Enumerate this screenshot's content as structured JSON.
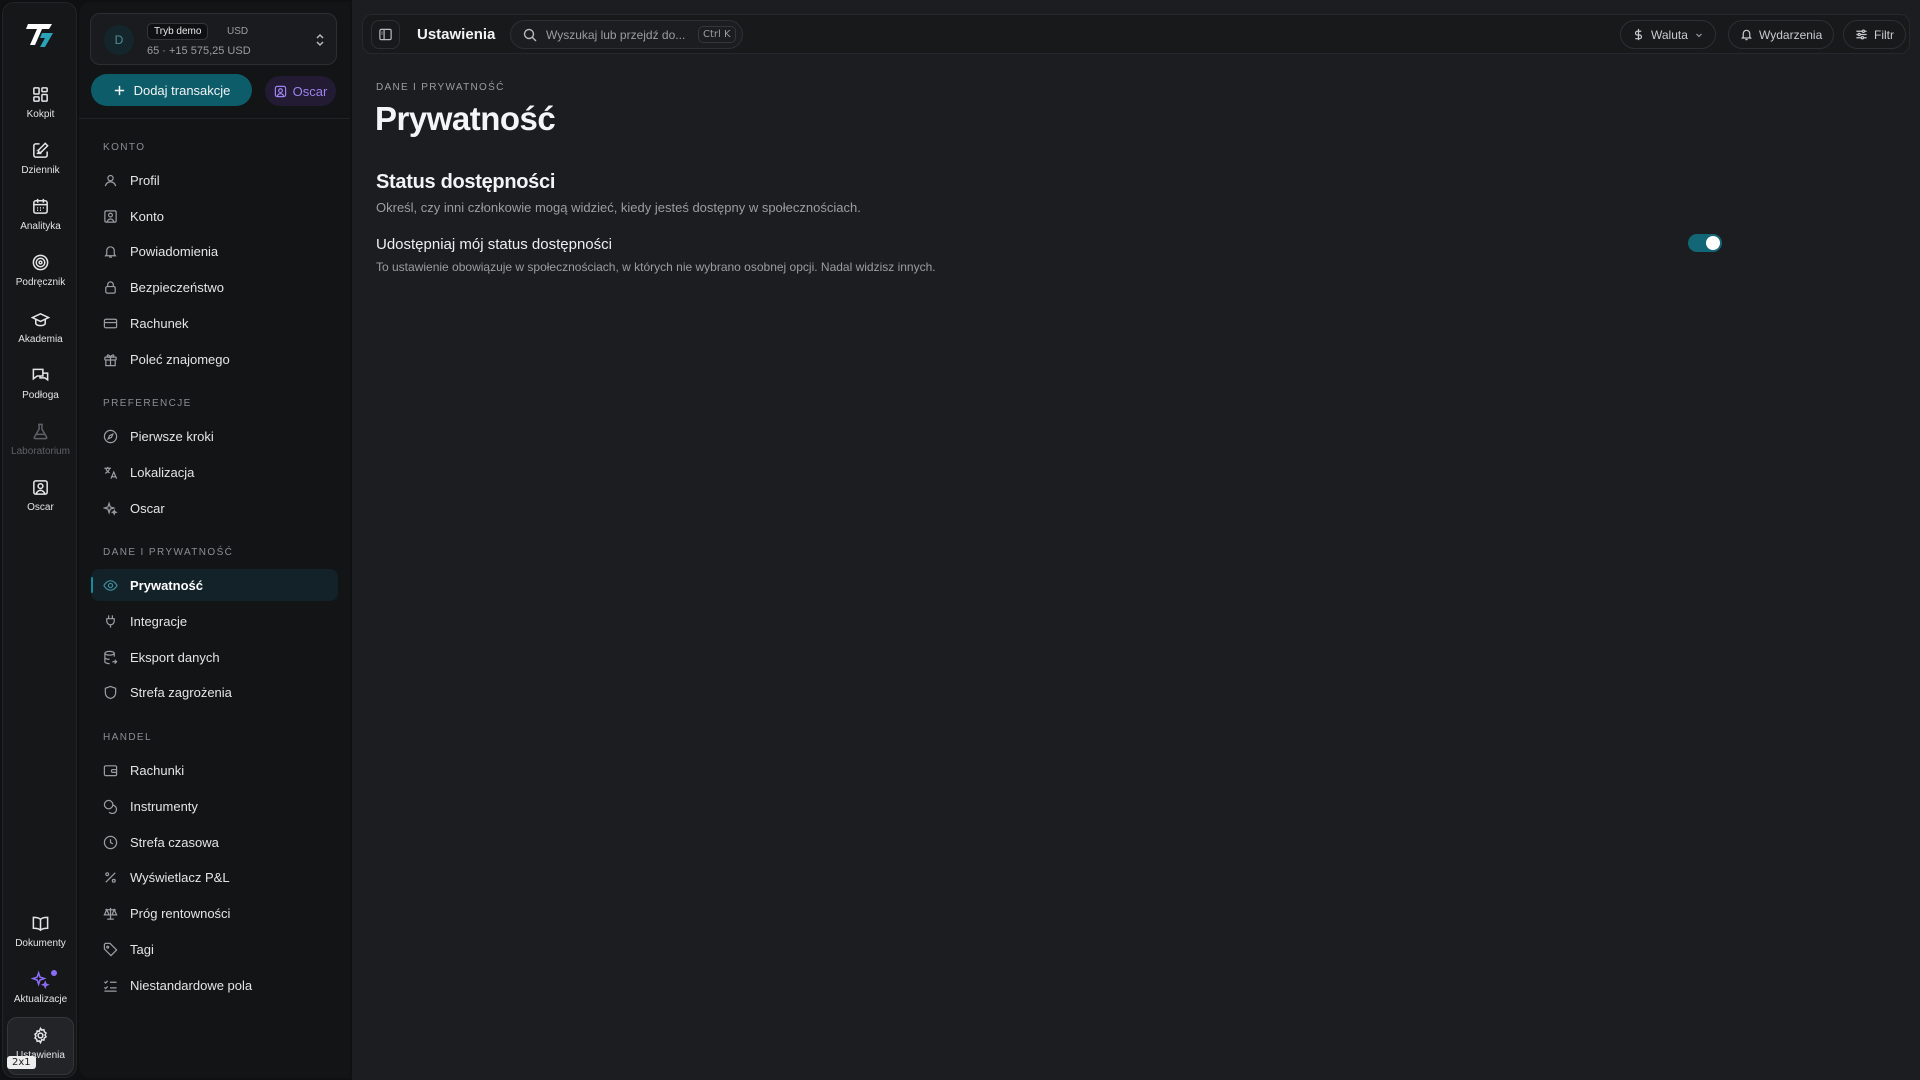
{
  "rail": {
    "items": [
      {
        "label": "Kokpit",
        "icon": "grid-icon"
      },
      {
        "label": "Dziennik",
        "icon": "journal-edit-icon"
      },
      {
        "label": "Analityka",
        "icon": "calendar-icon"
      },
      {
        "label": "Podręcznik",
        "icon": "target-icon"
      },
      {
        "label": "Akademia",
        "icon": "graduation-cap-icon"
      },
      {
        "label": "Podłoga",
        "icon": "chat-bubbles-icon"
      },
      {
        "label": "Laboratorium",
        "icon": "flask-icon"
      },
      {
        "label": "Oscar",
        "icon": "user-square-icon"
      }
    ],
    "bottom": [
      {
        "label": "Dokumenty",
        "icon": "book-open-icon"
      },
      {
        "label": "Aktualizacje",
        "icon": "sparkles-icon"
      },
      {
        "label": "Ustawienia",
        "icon": "gear-icon"
      }
    ],
    "scale_badge": "2x1"
  },
  "account": {
    "avatar_letter": "D",
    "mode_tag": "Tryb demo",
    "currency": "USD",
    "balance": "65 · +15 575,25 USD"
  },
  "actions": {
    "add_transaction": "Dodaj transakcje",
    "oscar": "Oscar"
  },
  "sidebar": {
    "sections": [
      {
        "title": "KONTO",
        "items": [
          "Profil",
          "Konto",
          "Powiadomienia",
          "Bezpieczeństwo",
          "Rachunek",
          "Poleć znajomego"
        ]
      },
      {
        "title": "PREFERENCJE",
        "items": [
          "Pierwsze kroki",
          "Lokalizacja",
          "Oscar"
        ]
      },
      {
        "title": "DANE I PRYWATNOŚĆ",
        "items": [
          "Prywatność",
          "Integracje",
          "Eksport danych",
          "Strefa zagrożenia"
        ]
      },
      {
        "title": "HANDEL",
        "items": [
          "Rachunki",
          "Instrumenty",
          "Strefa czasowa",
          "Wyświetlacz P&L",
          "Próg rentowności",
          "Tagi",
          "Niestandardowe pola"
        ]
      }
    ],
    "active_item": "Prywatność"
  },
  "topbar": {
    "title": "Ustawienia",
    "search_placeholder": "Wyszukaj lub przejdź do...",
    "search_shortcut": "Ctrl K",
    "currency_label": "Waluta",
    "events_label": "Wydarzenia",
    "filter_label": "Filtr"
  },
  "page": {
    "breadcrumb": "DANE I PRYWATNOŚĆ",
    "title": "Prywatność",
    "section_title": "Status dostępności",
    "section_description": "Określ, czy inni członkowie mogą widzieć, kiedy jesteś dostępny w społecznościach.",
    "setting_label": "Udostępniaj mój status dostępności",
    "setting_description": "To ustawienie obowiązuje w społecznościach, w których nie wybrano osobnej opcji. Nadal widzisz innych.",
    "setting_enabled": true
  },
  "colors": {
    "accent_teal": "#0d5c6a",
    "oscar_purple": "#9d82ee",
    "background": "#1c1d20"
  }
}
